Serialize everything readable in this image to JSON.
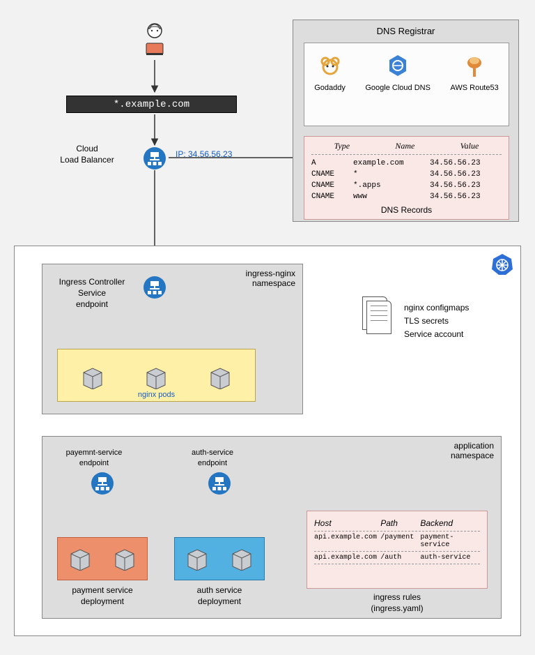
{
  "user": {
    "role": "user"
  },
  "domain_bar": "*.example.com",
  "load_balancer": {
    "label": "Cloud\nLoad Balancer",
    "ip_label": "IP: 34.56.56.23"
  },
  "dns": {
    "title": "DNS Registrar",
    "providers": {
      "godaddy": "Godaddy",
      "gcloud": "Google Cloud DNS",
      "route53": "AWS Route53"
    },
    "records_label": "DNS Records",
    "columns": {
      "type": "Type",
      "name": "Name",
      "value": "Value"
    },
    "records": [
      {
        "type": "A",
        "name": "example.com",
        "value": "34.56.56.23"
      },
      {
        "type": "CNAME",
        "name": "*",
        "value": "34.56.56.23"
      },
      {
        "type": "CNAME",
        "name": "*.apps",
        "value": "34.56.56.23"
      },
      {
        "type": "CNAME",
        "name": "www",
        "value": "34.56.56.23"
      }
    ]
  },
  "ingress_ns": {
    "title": "ingress-nginx\nnamespace",
    "controller_label": "Ingress Controller\nService\nendpoint",
    "pods_label": "nginx pods"
  },
  "config_docs": {
    "line1": "nginx configmaps",
    "line2": "TLS secrets",
    "line3": "Service account"
  },
  "app_ns": {
    "title": "application\nnamespace",
    "payment_endpoint": "payemnt-service\nendpoint",
    "auth_endpoint": "auth-service\nendpoint",
    "payment_dep": "payment service\ndeployment",
    "auth_dep": "auth service\ndeployment"
  },
  "ingress_rules": {
    "title": "ingress rules\n(ingress.yaml)",
    "columns": {
      "host": "Host",
      "path": "Path",
      "backend": "Backend"
    },
    "rows": [
      {
        "host": "api.example.com",
        "path": "/payment",
        "backend": "payment-service"
      },
      {
        "host": "api.example.com",
        "path": "/auth",
        "backend": "auth-service"
      }
    ]
  }
}
